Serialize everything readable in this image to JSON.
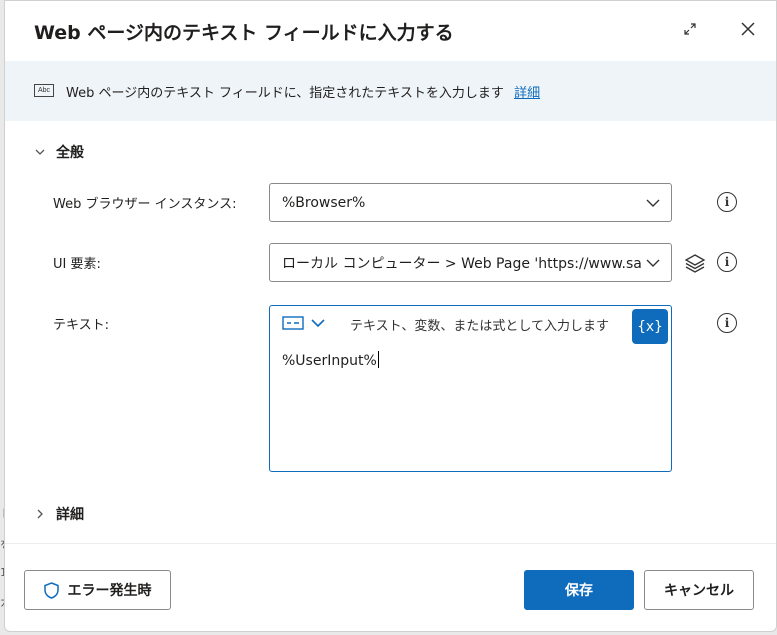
{
  "dialog": {
    "title": "Web ページ内のテキスト フィールドに入力する",
    "info": {
      "icon_text": "Abc",
      "text": "Web ページ内のテキスト フィールドに、指定されたテキストを入力します",
      "link": "詳細"
    },
    "sections": {
      "general": "全般",
      "advanced": "詳細"
    },
    "fields": {
      "browser": {
        "label": "Web ブラウザー インスタンス:",
        "value": "%Browser%"
      },
      "ui_element": {
        "label": "UI 要素:",
        "value": "ローカル コンピューター > Web Page 'https://www.saiyasune.com/'"
      },
      "text": {
        "label": "テキスト:",
        "hint": "テキスト、変数、または式として入力します",
        "value": "%UserInput%",
        "var_button": "{x}"
      }
    },
    "buttons": {
      "on_error": "エラー発生時",
      "save": "保存",
      "cancel": "キャンセル"
    },
    "colors": {
      "accent": "#0f6cbd",
      "info_bar": "#eff4f9"
    }
  },
  "backdrop_fragments": [
    "ト",
    "を",
    "1",
    "ガ"
  ]
}
